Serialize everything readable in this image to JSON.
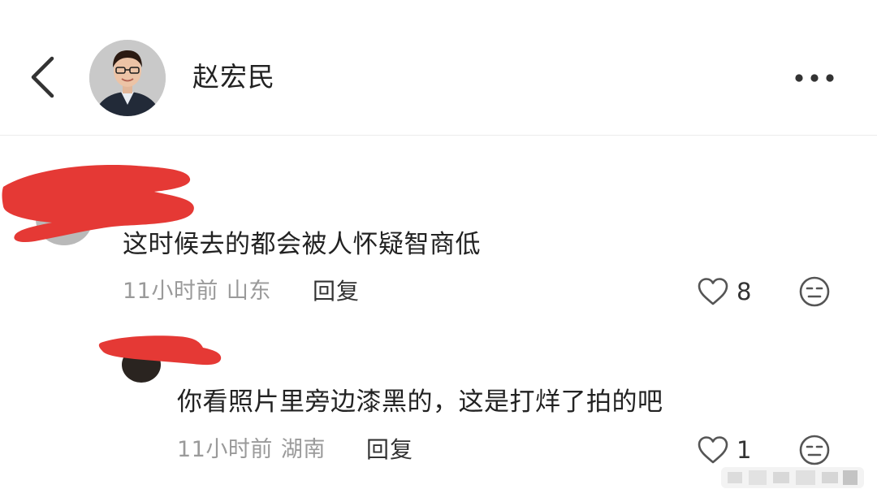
{
  "header": {
    "username": "赵宏民"
  },
  "comments": [
    {
      "text": "这时候去的都会被人怀疑智商低",
      "time": "11小时前",
      "location": "山东",
      "reply_label": "回复",
      "likes": "8"
    },
    {
      "text": "你看照片里旁边漆黑的，这是打烊了拍的吧",
      "time": "11小时前",
      "location": "湖南",
      "reply_label": "回复",
      "likes": "1"
    }
  ],
  "colors": {
    "redaction": "#e53935",
    "meta_gray": "#9a9a9a",
    "icon_gray": "#555555",
    "divider": "#ececec"
  },
  "icons": {
    "back": "chevron-left-icon",
    "more": "more-dots-icon",
    "like": "heart-outline-icon",
    "emoji": "neutral-face-icon"
  }
}
